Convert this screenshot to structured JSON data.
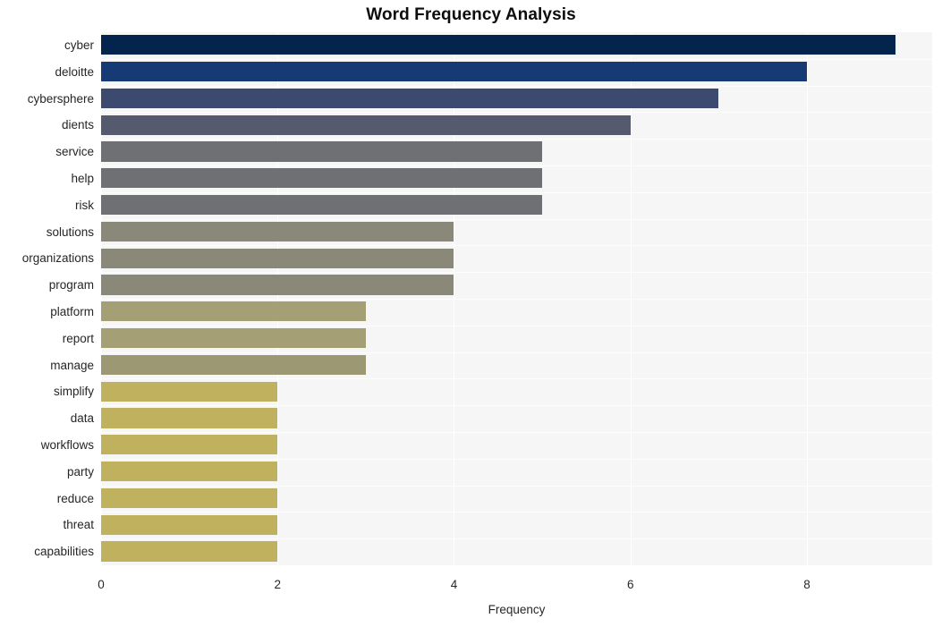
{
  "chart_data": {
    "type": "bar",
    "orientation": "horizontal",
    "title": "Word Frequency Analysis",
    "xlabel": "Frequency",
    "ylabel": "",
    "categories": [
      "cyber",
      "deloitte",
      "cybersphere",
      "dients",
      "service",
      "help",
      "risk",
      "solutions",
      "organizations",
      "program",
      "platform",
      "report",
      "manage",
      "simplify",
      "data",
      "workflows",
      "party",
      "reduce",
      "threat",
      "capabilities"
    ],
    "values": [
      9,
      8,
      7,
      6,
      5,
      5,
      5,
      4,
      4,
      4,
      3,
      3,
      3,
      2,
      2,
      2,
      2,
      2,
      2,
      2
    ],
    "bar_colors": [
      "#03244d",
      "#163a73",
      "#3d4a70",
      "#555a6e",
      "#6e7074",
      "#6e7074",
      "#6e7074",
      "#8a8879",
      "#8a8879",
      "#8a8879",
      "#a49f74",
      "#a49f74",
      "#9d9874",
      "#c0b15f",
      "#c0b15f",
      "#c0b15f",
      "#c0b15f",
      "#c0b15f",
      "#c0b15f",
      "#c0b15f"
    ],
    "xticks": [
      0,
      2,
      4,
      6,
      8
    ],
    "xtick_labels": [
      "0",
      "2",
      "4",
      "6",
      "8"
    ],
    "xlim": [
      0,
      9.42
    ],
    "grid": true,
    "grid_color": "#ffffff",
    "plot_background": "#f6f6f7",
    "figure_background": "#ffffff",
    "legend": null
  }
}
